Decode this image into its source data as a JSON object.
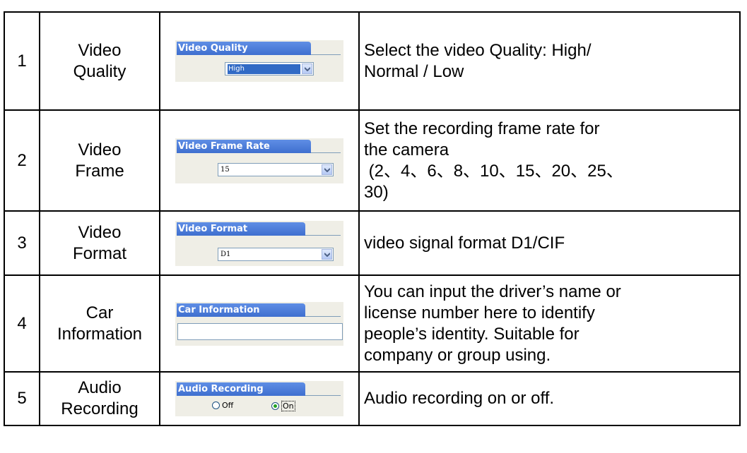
{
  "rows": [
    {
      "num": "1",
      "name": "Video\nQuality",
      "panel": {
        "tab": "Video Quality",
        "value": "High"
      },
      "desc": "Select the video Quality: High/\nNormal / Low"
    },
    {
      "num": "2",
      "name": "Video\nFrame",
      "panel": {
        "tab": "Video Frame Rate",
        "value": "15"
      },
      "desc": "Set the recording frame rate for\nthe camera\n (2、4、6、8、10、15、20、25、\n30)"
    },
    {
      "num": "3",
      "name": "Video\nFormat",
      "panel": {
        "tab": "Video Format",
        "value": "D1"
      },
      "desc": "video signal format D1/CIF"
    },
    {
      "num": "4",
      "name": "Car\nInformation",
      "panel": {
        "tab": "Car Information",
        "value": ""
      },
      "desc": "You can input the driver’s name or\nlicense number here to identify\npeople’s identity. Suitable for\ncompany or group using."
    },
    {
      "num": "5",
      "name": "Audio\nRecording",
      "panel": {
        "tab": "Audio Recording",
        "off_label": "Off",
        "on_label": "On",
        "selected": "On"
      },
      "desc": "Audio recording on or off."
    }
  ],
  "icons": {
    "dropdown": "chevron-down-icon",
    "radio": "radio-icon"
  },
  "colors": {
    "tab_blue": "#4a7bd9",
    "panel_bg": "#efeee6",
    "select_highlight": "#316ac5",
    "radio_dot": "#21a121"
  }
}
